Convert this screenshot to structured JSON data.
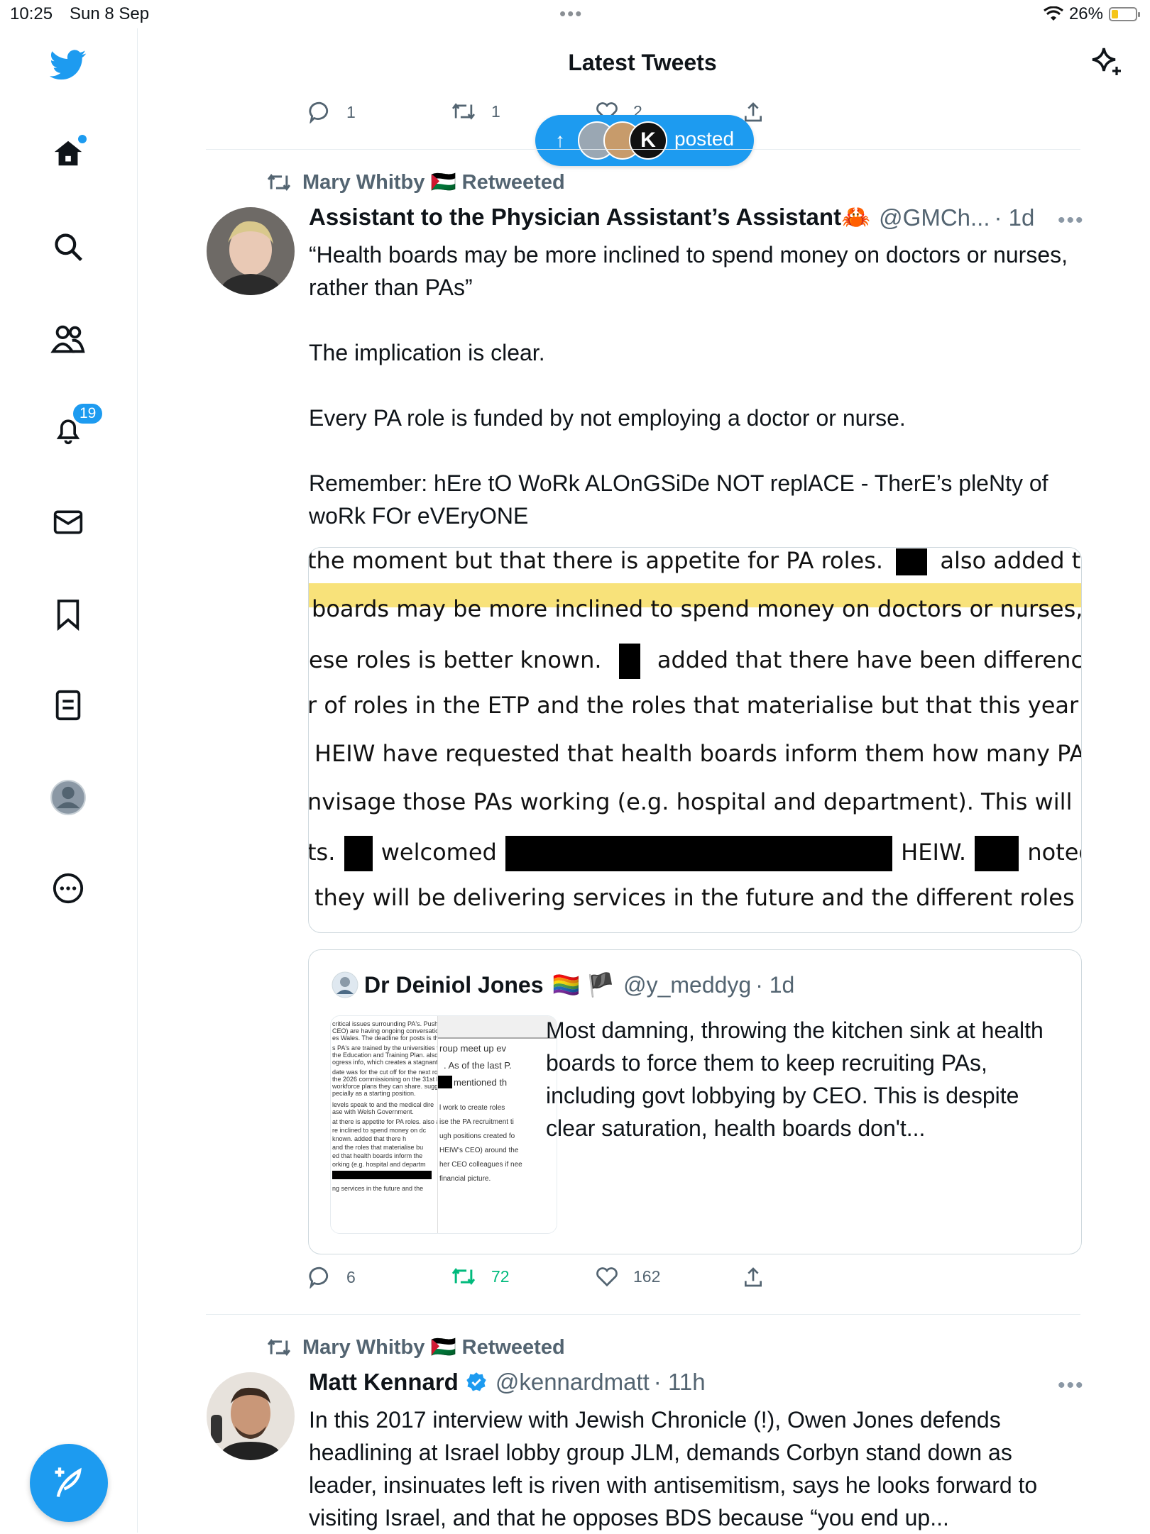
{
  "status_bar": {
    "time": "10:25",
    "date": "Sun 8 Sep",
    "battery": "26%"
  },
  "header": {
    "title": "Latest Tweets"
  },
  "sidebar": {
    "notification_count": "19"
  },
  "prev_tweet_actions": {
    "replies": "1",
    "retweets": "1",
    "likes": "2"
  },
  "new_posts_pill": {
    "label": "posted"
  },
  "tweet1": {
    "retweeted_by": "Mary Whitby 🇵🇸 Retweeted",
    "author_name": "Assistant to the Physician Assistant’s Assistant🦀",
    "handle": "@GMCh...",
    "time": "· 1d",
    "text": "“Health boards may be more inclined to spend money on doctors or nurses, rather than PAs”\n\nThe implication is clear.\n\nEvery PA role is funded by not employing a doctor or nurse.\n\nRemember: hEre tO WoRk ALOnGSiDe NOT replACE - TherE’s pleNty of woRk FOr eVEryONE",
    "image_lines": [
      {
        "a": "the moment but that there is appetite for PA roles.",
        "b": "also added tha"
      },
      {
        "a": "boards may be more inclined to spend money on doctors or nurses, rat"
      },
      {
        "a": "ese roles is better known.",
        "b": "added that there have been differenc"
      },
      {
        "a": "r of roles in the ETP and the roles that materialise but that this year dur"
      },
      {
        "a": "HEIW have requested that health boards inform them how many PA rol"
      },
      {
        "a": "nvisage those PAs working (e.g. hospital and department). This will be ben"
      },
      {
        "a": "ts.",
        "b": "welcomed",
        "c": "HEIW.",
        "d": "noted th"
      },
      {
        "a": "they will be delivering services in the future and the different roles that"
      }
    ],
    "quote": {
      "author_name": "Dr Deiniol Jones",
      "flags": "🏳️‍🌈 🏴",
      "handle": "@y_meddyg",
      "time": "· 1d",
      "text": "Most damning, throwing the kitchen sink at health boards to force them to keep recruiting PAs, including govt lobbying by CEO. This is despite clear saturation, health boards don't...",
      "thumb_left": [
        "critical issues surrounding PA's. Push-Mangel (HE",
        "CEO) are having ongoing conversations with the",
        "es Wales. The deadline for posts is the end of May.",
        "s PA's are trained by the universities from the numb",
        "the Education and Training Plan.   also mentioned",
        "ogress info, which creates a stagnant situation.",
        "date was for the cut off for the next round of commis",
        "the 2026 commissioning on the 31st March.   querie",
        "workforce plans they can share.   suggested HBs",
        "pecially as a starting position.",
        "levels speak to           and the medical dire",
        "ase with Welsh Government.",
        "at there is appetite for PA roles.   also added",
        "re inclined to spend money on dc",
        "known.   added that there h",
        "and the roles that materialise bu",
        "ed that health boards inform the",
        "orking (e.g. hospital and departm",
        "",
        "ng services in the future and the"
      ],
      "thumb_right": [
        "roup meet up ev",
        ". As of the last P.",
        "mentioned th",
        "l work to create roles",
        "ise the PA recruitment ti",
        "ugh positions created fo",
        "HEIW's CEO) around the",
        "her CEO colleagues if nee",
        "financial picture."
      ]
    },
    "replies": "6",
    "retweets": "72",
    "likes": "162"
  },
  "tweet2": {
    "retweeted_by": "Mary Whitby 🇵🇸 Retweeted",
    "author_name": "Matt Kennard",
    "handle": "@kennardmatt",
    "time": "· 11h",
    "text": "In this 2017 interview with Jewish Chronicle (!), Owen Jones defends headlining at Israel lobby group JLM, demands Corbyn stand down as leader, insinuates left is riven with antisemitism, says he looks forward to visiting Israel, and that he opposes BDS because “you end up..."
  },
  "colors": {
    "accent": "#1d9bf0",
    "retweet_green": "#00ba7c",
    "muted": "#536471",
    "highlight": "#f8e27a"
  }
}
